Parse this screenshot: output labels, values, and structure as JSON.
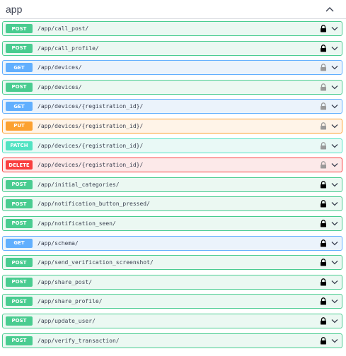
{
  "section": {
    "title": "app",
    "icon": "chevron-up-icon"
  },
  "colors": {
    "post": "#49cc90",
    "get": "#61affe",
    "put": "#fca130",
    "patch": "#50e3c2",
    "delete": "#f93e3e"
  },
  "operations": [
    {
      "method": "POST",
      "kind": "post",
      "path": "/app/call_post/",
      "locked": true
    },
    {
      "method": "POST",
      "kind": "post",
      "path": "/app/call_profile/",
      "locked": true
    },
    {
      "method": "GET",
      "kind": "get",
      "path": "/app/devices/",
      "locked": false
    },
    {
      "method": "POST",
      "kind": "post",
      "path": "/app/devices/",
      "locked": false
    },
    {
      "method": "GET",
      "kind": "get",
      "path": "/app/devices/{registration_id}/",
      "locked": false
    },
    {
      "method": "PUT",
      "kind": "put",
      "path": "/app/devices/{registration_id}/",
      "locked": false
    },
    {
      "method": "PATCH",
      "kind": "patch",
      "path": "/app/devices/{registration_id}/",
      "locked": false
    },
    {
      "method": "DELETE",
      "kind": "delete",
      "path": "/app/devices/{registration_id}/",
      "locked": false
    },
    {
      "method": "POST",
      "kind": "post",
      "path": "/app/initial_categories/",
      "locked": true
    },
    {
      "method": "POST",
      "kind": "post",
      "path": "/app/notification_button_pressed/",
      "locked": true
    },
    {
      "method": "POST",
      "kind": "post",
      "path": "/app/notification_seen/",
      "locked": true
    },
    {
      "method": "GET",
      "kind": "get",
      "path": "/app/schema/",
      "locked": true
    },
    {
      "method": "POST",
      "kind": "post",
      "path": "/app/send_verification_screenshot/",
      "locked": true
    },
    {
      "method": "POST",
      "kind": "post",
      "path": "/app/share_post/",
      "locked": true
    },
    {
      "method": "POST",
      "kind": "post",
      "path": "/app/share_profile/",
      "locked": true
    },
    {
      "method": "POST",
      "kind": "post",
      "path": "/app/update_user/",
      "locked": true
    },
    {
      "method": "POST",
      "kind": "post",
      "path": "/app/verify_transaction/",
      "locked": true
    }
  ]
}
